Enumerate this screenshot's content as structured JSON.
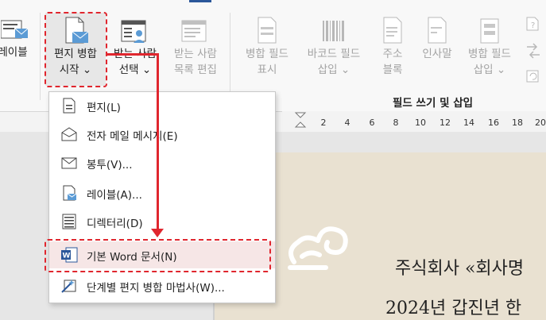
{
  "ribbon": {
    "buttons": [
      {
        "id": "labels",
        "line1": "레이블",
        "line2": ""
      },
      {
        "id": "start_merge",
        "line1": "편지 병합",
        "line2": "시작 ⌄"
      },
      {
        "id": "select_recipients",
        "line1": "받는 사람",
        "line2": "선택 ⌄"
      },
      {
        "id": "edit_recipients",
        "line1": "받는 사람",
        "line2": "목록 편집"
      },
      {
        "id": "highlight_fields",
        "line1": "병합 필드",
        "line2": "표시"
      },
      {
        "id": "barcode_field",
        "line1": "바코드 필드",
        "line2": "삽입 ⌄"
      },
      {
        "id": "address_block",
        "line1": "주소",
        "line2": "블록"
      },
      {
        "id": "greeting_line",
        "line1": "인사말",
        "line2": ""
      },
      {
        "id": "insert_merge_field",
        "line1": "병합 필드",
        "line2": "삽입 ⌄"
      }
    ],
    "group_label": "필드 쓰기 및 삽입"
  },
  "ruler": {
    "ticks": [
      "2",
      "4",
      "6",
      "8",
      "10",
      "12",
      "14",
      "16",
      "18",
      "20"
    ]
  },
  "menu": {
    "items": [
      {
        "label": "편지(L)",
        "icon": "letter-icon"
      },
      {
        "label": "전자 메일 메시지(E)",
        "icon": "email-message-icon"
      },
      {
        "label": "봉투(V)...",
        "icon": "envelope-icon"
      },
      {
        "label": "레이블(A)...",
        "icon": "label-icon"
      },
      {
        "label": "디렉터리(D)",
        "icon": "directory-icon"
      },
      {
        "label": "기본 Word 문서(N)",
        "icon": "word-document-icon"
      },
      {
        "label": "단계별 편지 병합 마법사(W)...",
        "icon": "wizard-icon"
      }
    ]
  },
  "document": {
    "line1": "주식회사 «회사명",
    "line2": "2024년 갑진년 한"
  },
  "colors": {
    "accent": "#e0262e",
    "word_blue": "#2b579a"
  }
}
